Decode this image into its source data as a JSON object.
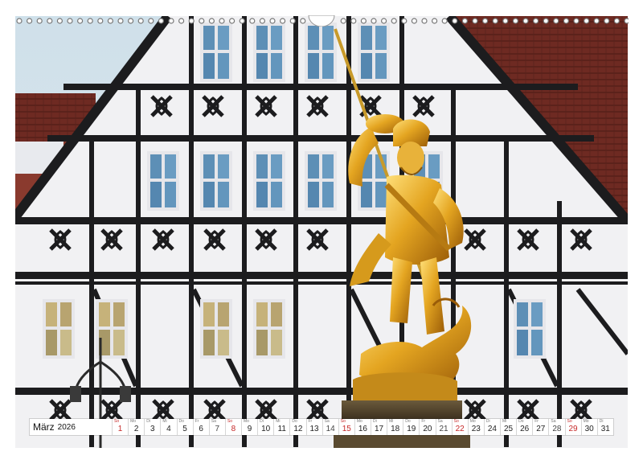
{
  "calendar": {
    "month": "März",
    "year": "2026",
    "days": [
      {
        "wd": "So",
        "num": "1",
        "sunday": true
      },
      {
        "wd": "Mo",
        "num": "2"
      },
      {
        "wd": "Di",
        "num": "3"
      },
      {
        "wd": "Mi",
        "num": "4"
      },
      {
        "wd": "Do",
        "num": "5"
      },
      {
        "wd": "Fr",
        "num": "6"
      },
      {
        "wd": "Sa",
        "num": "7"
      },
      {
        "wd": "So",
        "num": "8",
        "sunday": true
      },
      {
        "wd": "Mo",
        "num": "9"
      },
      {
        "wd": "Di",
        "num": "10"
      },
      {
        "wd": "Mi",
        "num": "11"
      },
      {
        "wd": "Do",
        "num": "12"
      },
      {
        "wd": "Fr",
        "num": "13"
      },
      {
        "wd": "Sa",
        "num": "14"
      },
      {
        "wd": "So",
        "num": "15",
        "sunday": true
      },
      {
        "wd": "Mo",
        "num": "16"
      },
      {
        "wd": "Di",
        "num": "17"
      },
      {
        "wd": "Mi",
        "num": "18"
      },
      {
        "wd": "Do",
        "num": "19"
      },
      {
        "wd": "Fr",
        "num": "20"
      },
      {
        "wd": "Sa",
        "num": "21"
      },
      {
        "wd": "So",
        "num": "22",
        "sunday": true
      },
      {
        "wd": "Mo",
        "num": "23"
      },
      {
        "wd": "Di",
        "num": "24"
      },
      {
        "wd": "Mi",
        "num": "25"
      },
      {
        "wd": "Do",
        "num": "26"
      },
      {
        "wd": "Fr",
        "num": "27"
      },
      {
        "wd": "Sa",
        "num": "28"
      },
      {
        "wd": "So",
        "num": "29",
        "sunday": true
      },
      {
        "wd": "Mo",
        "num": "30"
      },
      {
        "wd": "Di",
        "num": "31"
      }
    ]
  },
  "colors": {
    "sky": "#c9dbe6",
    "timber": "#1c1c1e",
    "plaster": "#f1f1f3",
    "roof": "#6e2a22",
    "window": "#5d8fb6",
    "gold": "#e0a21c",
    "sunday": "#c62828"
  }
}
